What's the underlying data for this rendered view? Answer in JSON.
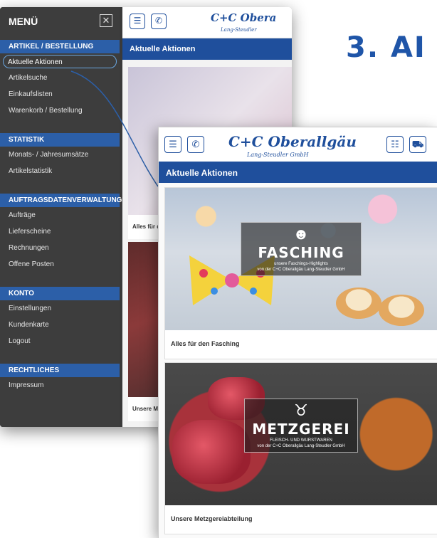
{
  "heading": "3. AI",
  "back_phone": {
    "menu": {
      "title": "MENÜ",
      "close_symbol": "✕",
      "sections": [
        {
          "label": "ARTIKEL / BESTELLUNG",
          "items": [
            "Aktuelle Aktionen",
            "Artikelsuche",
            "Einkaufslisten",
            "Warenkorb / Bestellung"
          ]
        },
        {
          "label": "STATISTIK",
          "items": [
            "Monats- / Jahresumsätze",
            "Artikelstatistik"
          ]
        },
        {
          "label": "AUFTRAGSDATENVERWALTUNG",
          "items": [
            "Aufträge",
            "Lieferscheine",
            "Rechnungen",
            "Offene Posten"
          ]
        },
        {
          "label": "KONTO",
          "items": [
            "Einstellungen",
            "Kundenkarte",
            "Logout"
          ]
        },
        {
          "label": "RECHTLICHES",
          "items": [
            "Impressum"
          ]
        }
      ]
    },
    "logo_main": "C+C Obera",
    "logo_sub": "Lang-Steudler",
    "section_title": "Aktuelle Aktionen",
    "caption_1": "Alles für d",
    "caption_2": "Unsere M"
  },
  "front_phone": {
    "logo_main": "C+C Oberallgäu",
    "logo_sub": "Lang-Steudler GmbH",
    "section_title": "Aktuelle Aktionen",
    "cards": [
      {
        "title": "FASCHING",
        "subtitle": "unsere Faschings-Highlights",
        "subtitle2": "von der C+C Oberallgäu Lang-Steudler GmbH",
        "caption": "Alles für den Fasching"
      },
      {
        "title": "METZGEREI",
        "subtitle": "FLEISCH- UND WURSTWAREN",
        "subtitle2": "von der C+C Oberallgäu Lang-Steudler GmbH",
        "caption": "Unsere Metzgereiabteilung"
      }
    ]
  },
  "icons": {
    "menu": "☰",
    "phone": "✆",
    "list": "☷",
    "cart": "⛟",
    "mask": "☻",
    "cow": "♉"
  },
  "colors": {
    "brand_blue": "#1f4f9c",
    "menu_bg": "#3d3d3d",
    "section_blue": "#2c5fa8",
    "heading_blue": "#1f55a8"
  }
}
